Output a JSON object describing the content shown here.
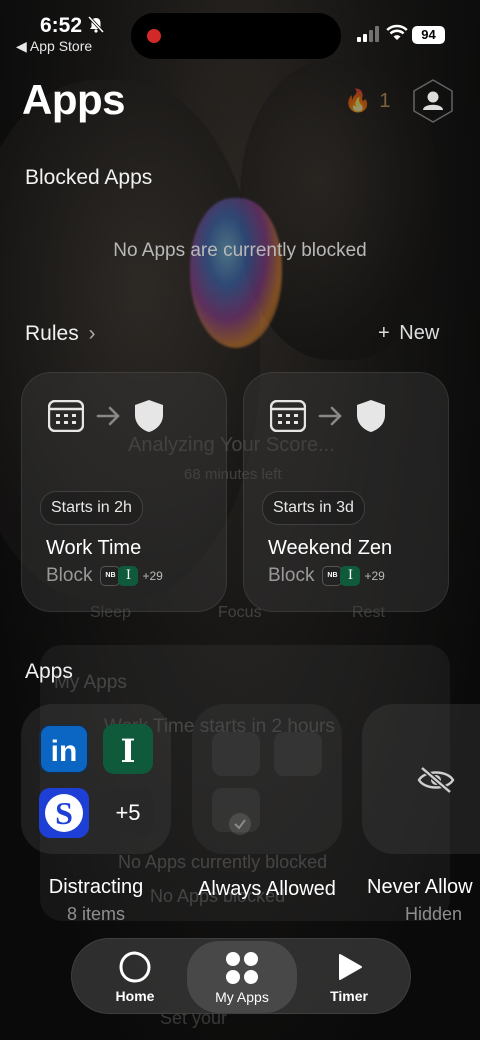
{
  "status_bar": {
    "time": "6:52",
    "back_label": "App Store",
    "battery": "94"
  },
  "header": {
    "title": "Apps",
    "streak_count": "1"
  },
  "blocked_apps": {
    "title": "Blocked Apps",
    "empty_text": "No Apps are currently blocked"
  },
  "rules": {
    "title": "Rules",
    "new_label": "New",
    "cards": [
      {
        "starts": "Starts in 2h",
        "name": "Work Time",
        "block_label": "Block",
        "more": "+29"
      },
      {
        "starts": "Starts in 3d",
        "name": "Weekend Zen",
        "block_label": "Block",
        "more": "+29"
      }
    ]
  },
  "apps": {
    "title": "Apps",
    "categories": [
      {
        "label": "Distracting",
        "sub": "8 items",
        "more": "+5"
      },
      {
        "label": "Always Allowed",
        "sub": ""
      },
      {
        "label": "Never Allow",
        "sub": "Hidden"
      }
    ]
  },
  "ghost_text": {
    "analyzing": "Analyzing Your Score...",
    "minutes_left": "68 minutes left",
    "sleep": "Sleep",
    "focus": "Focus",
    "rest": "Rest",
    "my_apps": "My Apps",
    "work_time_notice": "Work Time starts in 2 hours",
    "no_apps_currently": "No Apps currently blocked",
    "no_apps_blocked": "No Apps blocked",
    "set_your": "Set your"
  },
  "tabbar": {
    "tabs": [
      {
        "label": "Home"
      },
      {
        "label": "My Apps"
      },
      {
        "label": "Timer"
      }
    ],
    "active": "My Apps"
  },
  "colors": {
    "linkedin": "#0a66c2",
    "shazam_like": "#1d3fd6",
    "wiz_green": "#0e5a3a"
  }
}
